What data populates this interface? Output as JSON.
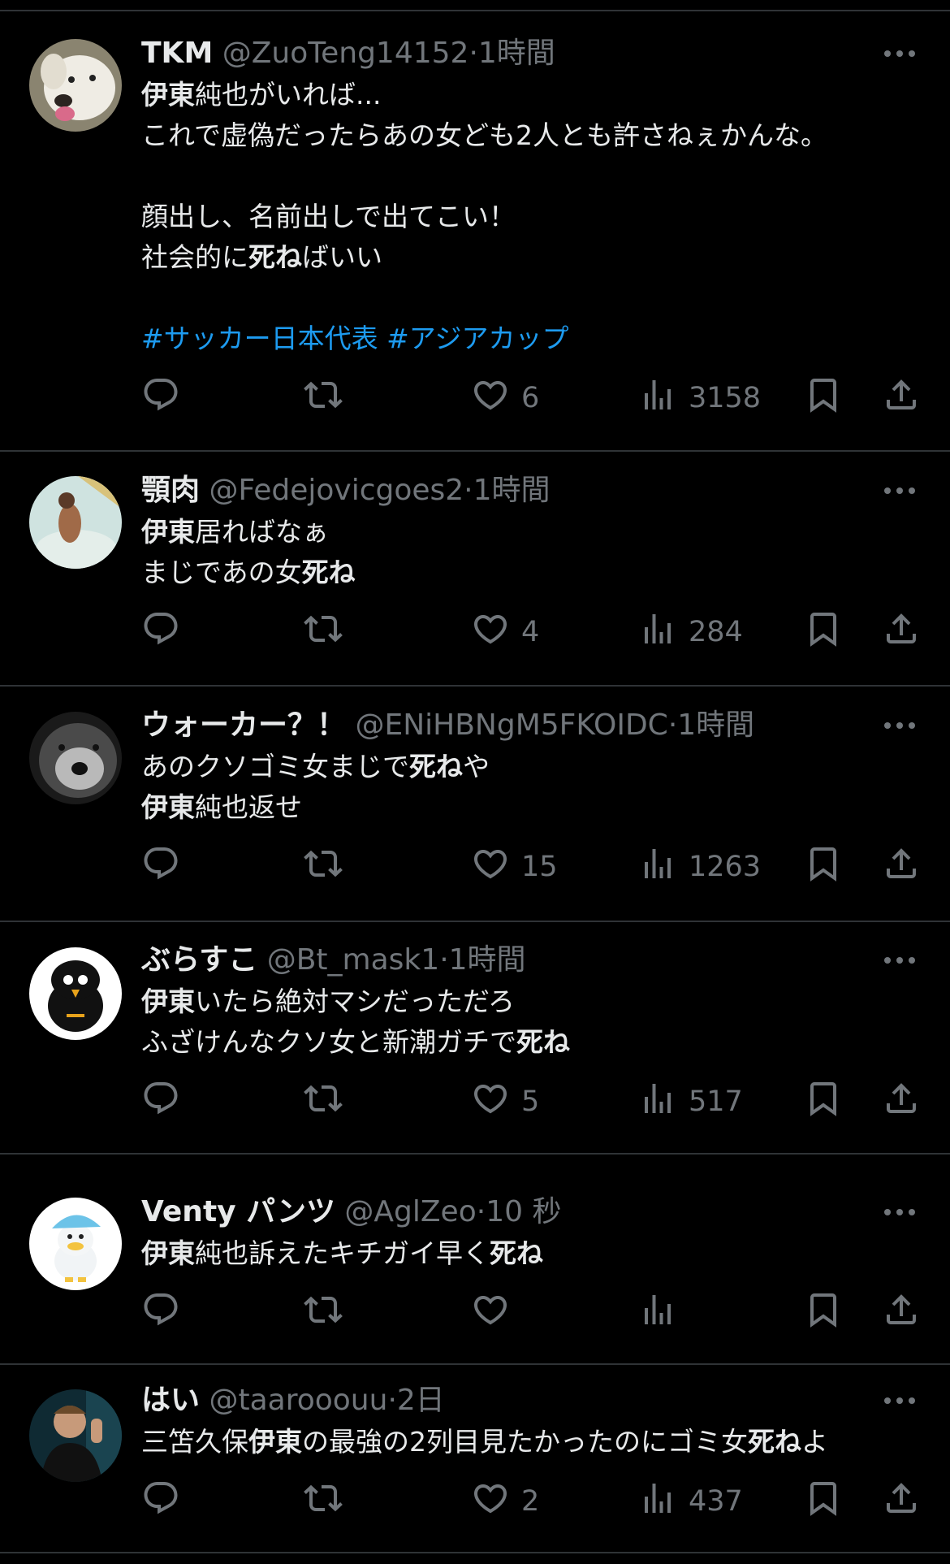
{
  "tweets": [
    {
      "name": "TKM",
      "handle": "@ZuoTeng14152",
      "time": "1時間",
      "lines": [
        [
          {
            "t": "伊東",
            "b": true
          },
          {
            "t": "純也がいれば..."
          }
        ],
        [
          {
            "t": "これで虚偽だったらあの女ども2人とも許さねぇかんな。"
          }
        ],
        [],
        [
          {
            "t": "顔出し、名前出しで出てこい！"
          }
        ],
        [
          {
            "t": "社会的に"
          },
          {
            "t": "死ね",
            "b": true
          },
          {
            "t": "ばいい"
          }
        ],
        [],
        [
          {
            "t": "#サッカー日本代表 #アジアカップ",
            "h": true
          }
        ]
      ],
      "likes": "6",
      "views": "3158"
    },
    {
      "name": "顎肉",
      "handle": "@Fedejovicgoes2",
      "time": "1時間",
      "lines": [
        [
          {
            "t": "伊東",
            "b": true
          },
          {
            "t": "居ればなぁ"
          }
        ],
        [
          {
            "t": "まじであの女"
          },
          {
            "t": "死ね",
            "b": true
          }
        ]
      ],
      "likes": "4",
      "views": "284"
    },
    {
      "name": "ウォーカー？！",
      "handle": "@ENiHBNgM5FKOIDC",
      "time": "1時間",
      "lines": [
        [
          {
            "t": "あのクソゴミ女まじで"
          },
          {
            "t": "死ね",
            "b": true
          },
          {
            "t": "や"
          }
        ],
        [
          {
            "t": "伊東",
            "b": true
          },
          {
            "t": "純也返せ"
          }
        ]
      ],
      "likes": "15",
      "views": "1263"
    },
    {
      "name": "ぶらすこ",
      "handle": "@Bt_mask1",
      "time": "1時間",
      "lines": [
        [
          {
            "t": "伊東",
            "b": true
          },
          {
            "t": "いたら絶対マシだっただろ"
          }
        ],
        [
          {
            "t": "ふざけんなクソ女と新潮ガチで"
          },
          {
            "t": "死ね",
            "b": true
          }
        ]
      ],
      "likes": "5",
      "views": "517"
    },
    {
      "name": "Venty パンツ",
      "handle": "@AglZeo",
      "time": "10 秒",
      "lines": [
        [
          {
            "t": "伊東",
            "b": true
          },
          {
            "t": "純也訴えたキチガイ早く"
          },
          {
            "t": "死ね",
            "b": true
          }
        ]
      ],
      "likes": "",
      "views": ""
    },
    {
      "name": "はい",
      "handle": "@taarooouu",
      "time": "2日",
      "lines": [
        [
          {
            "t": "三笘久保"
          },
          {
            "t": "伊東",
            "b": true
          },
          {
            "t": "の最強の2列目見たかったのにゴミ女"
          },
          {
            "t": "死ね",
            "b": true
          },
          {
            "t": "よ"
          }
        ]
      ],
      "likes": "2",
      "views": "437"
    }
  ],
  "icons": {
    "reply": "reply-icon",
    "retweet": "retweet-icon",
    "like": "heart-icon",
    "views": "views-icon",
    "bookmark": "bookmark-icon",
    "share": "share-icon",
    "more": "more-icon"
  },
  "colors": {
    "background": "#000000",
    "text": "#e7e9ea",
    "secondary": "#71767b",
    "link": "#1d9bf0",
    "divider": "#2f3336"
  }
}
